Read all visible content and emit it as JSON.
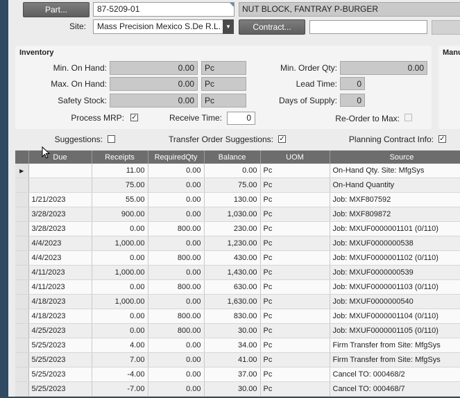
{
  "part": {
    "button_label": "Part...",
    "number": "87-5209-01",
    "description": "NUT BLOCK, FANTRAY P-BURGER"
  },
  "site": {
    "label": "Site:",
    "value": "Mass Precision Mexico S.De R.L. D",
    "contract_button": "Contract...",
    "contract_value": ""
  },
  "inventory": {
    "title": "Inventory",
    "min_on_hand_label": "Min. On Hand:",
    "min_on_hand": "0.00",
    "min_on_hand_uom": "Pc",
    "max_on_hand_label": "Max. On Hand:",
    "max_on_hand": "0.00",
    "max_on_hand_uom": "Pc",
    "safety_stock_label": "Safety Stock:",
    "safety_stock": "0.00",
    "safety_stock_uom": "Pc",
    "process_mrp_label": "Process MRP:",
    "process_mrp_checked": true,
    "receive_time_label": "Receive Time:",
    "receive_time": "0",
    "min_order_qty_label": "Min. Order Qty:",
    "min_order_qty": "0.00",
    "lead_time_label": "Lead Time:",
    "lead_time": "0",
    "days_of_supply_label": "Days of Supply:",
    "days_of_supply": "0",
    "reorder_to_max_label": "Re-Order to Max:",
    "reorder_to_max_checked": false
  },
  "manufacturing_panel": {
    "title": "Manu"
  },
  "options": {
    "suggestions_label": "Suggestions:",
    "suggestions_checked": false,
    "transfer_label": "Transfer Order Suggestions:",
    "transfer_checked": true,
    "planning_label": "Planning Contract Info:",
    "planning_checked": true
  },
  "grid": {
    "columns": [
      "Due",
      "Receipts",
      "RequiredQty",
      "Balance",
      "UOM",
      "Source"
    ],
    "rows": [
      [
        "",
        "11.00",
        "0.00",
        "0.00",
        "Pc",
        "On-Hand Qty. Site: MfgSys"
      ],
      [
        "",
        "75.00",
        "0.00",
        "75.00",
        "Pc",
        "On-Hand Quantity"
      ],
      [
        "1/21/2023",
        "55.00",
        "0.00",
        "130.00",
        "Pc",
        "Job: MXF807592"
      ],
      [
        "3/28/2023",
        "900.00",
        "0.00",
        "1,030.00",
        "Pc",
        "Job: MXF809872"
      ],
      [
        "3/28/2023",
        "0.00",
        "800.00",
        "230.00",
        "Pc",
        "Job: MXUF0000001101 (0/110)"
      ],
      [
        "4/4/2023",
        "1,000.00",
        "0.00",
        "1,230.00",
        "Pc",
        "Job: MXUF0000000538"
      ],
      [
        "4/4/2023",
        "0.00",
        "800.00",
        "430.00",
        "Pc",
        "Job: MXUF0000001102 (0/110)"
      ],
      [
        "4/11/2023",
        "1,000.00",
        "0.00",
        "1,430.00",
        "Pc",
        "Job: MXUF0000000539"
      ],
      [
        "4/11/2023",
        "0.00",
        "800.00",
        "630.00",
        "Pc",
        "Job: MXUF0000001103 (0/110)"
      ],
      [
        "4/18/2023",
        "1,000.00",
        "0.00",
        "1,630.00",
        "Pc",
        "Job: MXUF0000000540"
      ],
      [
        "4/18/2023",
        "0.00",
        "800.00",
        "830.00",
        "Pc",
        "Job: MXUF0000001104 (0/110)"
      ],
      [
        "4/25/2023",
        "0.00",
        "800.00",
        "30.00",
        "Pc",
        "Job: MXUF0000001105 (0/110)"
      ],
      [
        "5/25/2023",
        "4.00",
        "0.00",
        "34.00",
        "Pc",
        "Firm Transfer from Site: MfgSys"
      ],
      [
        "5/25/2023",
        "7.00",
        "0.00",
        "41.00",
        "Pc",
        "Firm Transfer from Site: MfgSys"
      ],
      [
        "5/25/2023",
        "-4.00",
        "0.00",
        "37.00",
        "Pc",
        "Cancel TO: 000468/2"
      ],
      [
        "5/25/2023",
        "-7.00",
        "0.00",
        "30.00",
        "Pc",
        "Cancel TO: 000468/7"
      ]
    ]
  }
}
